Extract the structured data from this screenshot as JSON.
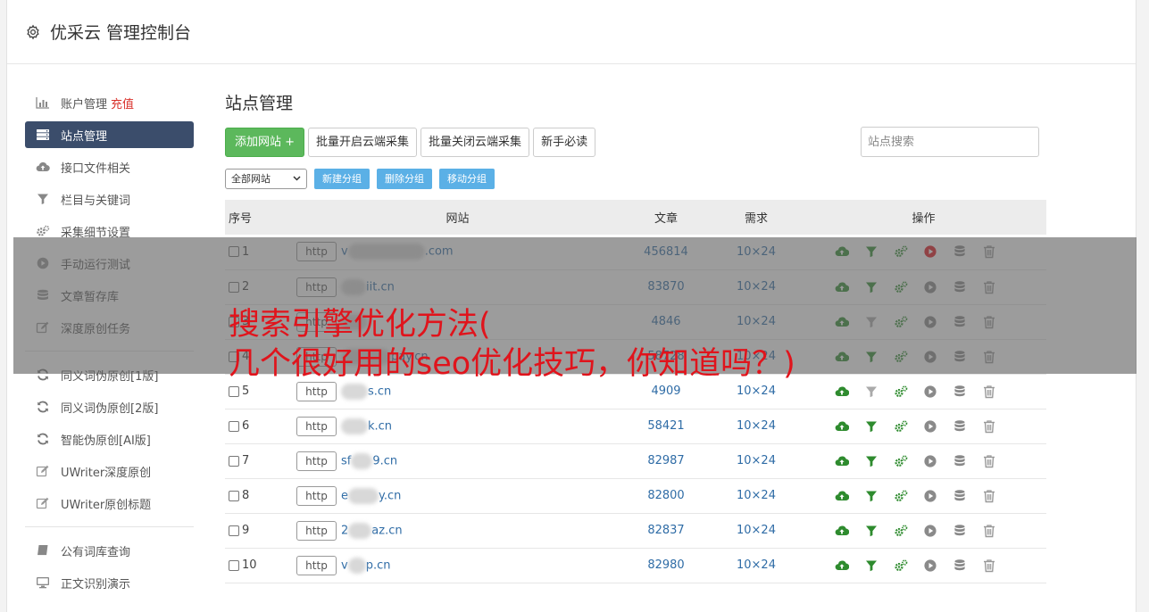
{
  "app": {
    "title": "优采云 管理控制台",
    "icon": "gear-icon"
  },
  "sidebar": {
    "group1": [
      {
        "label": "账户管理",
        "extra": "充值",
        "icon": "bar-chart-icon",
        "active": false
      },
      {
        "label": "站点管理",
        "icon": "server-icon",
        "active": true
      },
      {
        "label": "接口文件相关",
        "icon": "cloud-upload-icon",
        "active": false
      },
      {
        "label": "栏目与关键词",
        "icon": "filter-icon",
        "active": false
      },
      {
        "label": "采集细节设置",
        "icon": "cogs-icon",
        "active": false
      },
      {
        "label": "手动运行测试",
        "icon": "play-icon",
        "active": false
      },
      {
        "label": "文章暂存库",
        "icon": "database-icon",
        "active": false
      },
      {
        "label": "深度原创任务",
        "icon": "edit-icon",
        "active": false
      }
    ],
    "group2": [
      {
        "label": "同义词伪原创[1版]",
        "icon": "refresh-icon"
      },
      {
        "label": "同义词伪原创[2版]",
        "icon": "refresh-icon"
      },
      {
        "label": "智能伪原创[AI版]",
        "icon": "refresh-icon"
      },
      {
        "label": "UWriter深度原创",
        "icon": "edit-icon"
      },
      {
        "label": "UWriter原创标题",
        "icon": "edit-icon"
      }
    ],
    "group3": [
      {
        "label": "公有词库查询",
        "icon": "book-icon"
      },
      {
        "label": "正文识别演示",
        "icon": "monitor-icon"
      }
    ]
  },
  "main": {
    "title": "站点管理",
    "buttons": {
      "add": "添加网站 +",
      "batch_open": "批量开启云端采集",
      "batch_close": "批量关闭云端采集",
      "guide": "新手必读"
    },
    "search_placeholder": "站点搜索",
    "group_select": "全部网站",
    "group_buttons": {
      "new": "新建分组",
      "delete": "删除分组",
      "move": "移动分组"
    },
    "table": {
      "headers": {
        "no": "序号",
        "site": "网站",
        "articles": "文章",
        "demand": "需求",
        "ops": "操作"
      },
      "rows": [
        {
          "no": "1",
          "prefix": "http",
          "domain_start": "v",
          "domain_end": ".com",
          "articles": "456814",
          "demand": "10×24",
          "active": true
        },
        {
          "no": "2",
          "prefix": "http",
          "domain_start": "",
          "domain_end": "iit.cn",
          "articles": "83870",
          "demand": "10×24",
          "active": false
        },
        {
          "no": "3",
          "prefix": "http",
          "domain_start": "",
          "domain_end": "",
          "articles": "4846",
          "demand": "10×24",
          "active": false
        },
        {
          "no": "4",
          "prefix": "http",
          "domain_start": "",
          "domain_end": "pay.cn",
          "articles": "58728",
          "demand": "10×24",
          "active": false
        },
        {
          "no": "5",
          "prefix": "http",
          "domain_start": "",
          "domain_end": "s.cn",
          "articles": "4909",
          "demand": "10×24",
          "active": false
        },
        {
          "no": "6",
          "prefix": "http",
          "domain_start": "",
          "domain_end": "k.cn",
          "articles": "58421",
          "demand": "10×24",
          "active": false
        },
        {
          "no": "7",
          "prefix": "http",
          "domain_start": "sf",
          "domain_end": "9.cn",
          "articles": "82987",
          "demand": "10×24",
          "active": false
        },
        {
          "no": "8",
          "prefix": "http",
          "domain_start": "e",
          "domain_end": "y.cn",
          "articles": "82800",
          "demand": "10×24",
          "active": false
        },
        {
          "no": "9",
          "prefix": "http",
          "domain_start": "2",
          "domain_end": "az.cn",
          "articles": "82837",
          "demand": "10×24",
          "active": false
        },
        {
          "no": "10",
          "prefix": "http",
          "domain_start": "v",
          "domain_end": "p.cn",
          "articles": "82980",
          "demand": "10×24",
          "active": false
        }
      ],
      "op_icons": [
        "cloud-upload-icon",
        "filter-icon",
        "cogs-icon",
        "play-icon",
        "database-icon",
        "trash-icon"
      ]
    }
  },
  "overlay": {
    "line1": "搜索引擎优化方法(",
    "line2": "几个很好用的seo优化技巧，你知道吗？)"
  },
  "colors": {
    "active_sidebar": "#3b4d6b",
    "green_button": "#5cb85c",
    "blue_button": "#5bb0e6",
    "link": "#2f6ca6",
    "recharge": "#d9302a",
    "headline": "#e0141c",
    "icon_green": "#2e8b2e",
    "play_active": "#e0141c"
  }
}
